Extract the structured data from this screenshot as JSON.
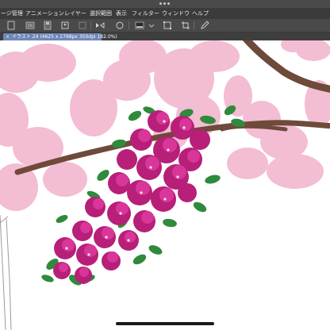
{
  "menu": {
    "items": [
      "ージ管理",
      "アニメーション",
      "レイヤー",
      "選択範囲",
      "表示",
      "フィルター",
      "ウィンドウ",
      "ヘルプ"
    ]
  },
  "toolbar": {
    "icons": [
      "new-page-icon",
      "open-icon",
      "save-icon",
      "undo-icon",
      "redo-icon",
      "flip-icon",
      "lasso-icon",
      "layer-fill-icon",
      "transform-icon",
      "crop-icon",
      "pen-icon"
    ]
  },
  "document_tab": {
    "close_glyph": "×",
    "title": "イラスト 24 (4625 x 2768px 350dpi 182.0%)"
  },
  "colors": {
    "menubar": "#3b3b3b",
    "toolbar": "#4a4a4a",
    "tab_active": "#6f86b7",
    "blossom_light": "#f2b6cf",
    "blossom_main": "#c92a87",
    "branch": "#6e4a3a",
    "leaf": "#2f8a3c"
  }
}
